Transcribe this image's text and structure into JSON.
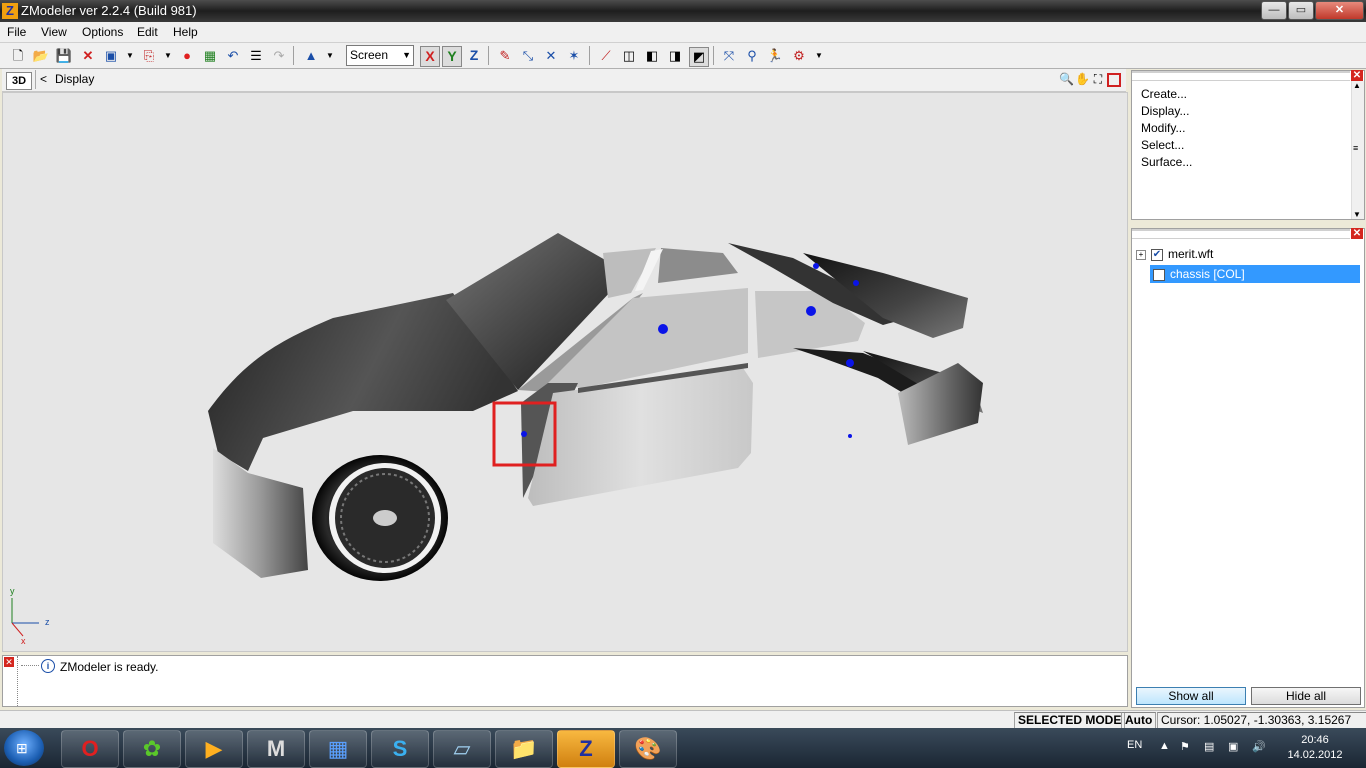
{
  "window": {
    "title": "ZModeler ver 2.2.4 (Build 981)",
    "app_icon": "Z",
    "buttons": {
      "minimize": "—",
      "maximize": "▭",
      "close": "✕"
    }
  },
  "menu": [
    "File",
    "View",
    "Options",
    "Edit",
    "Help"
  ],
  "toolbar": {
    "coord_mode": "Screen",
    "axes": [
      "X",
      "Y",
      "Z"
    ]
  },
  "viewport": {
    "mode_label": "3D",
    "breadcrumb_arrow": "<",
    "breadcrumb": "Display",
    "axis_y": "y",
    "axis_z": "z",
    "axis_x": "x"
  },
  "commands_panel": {
    "items": [
      "Create...",
      "Display...",
      "Modify...",
      "Select...",
      "Surface..."
    ]
  },
  "objects_panel": {
    "items": [
      {
        "label": "merit.wft",
        "checked": true,
        "expander": "+"
      },
      {
        "label": "chassis [COL]",
        "checked": false,
        "selected": true
      }
    ],
    "show_all": "Show all",
    "hide_all": "Hide all"
  },
  "log": {
    "message": "ZModeler is ready.",
    "info_icon": "i"
  },
  "statusbar": {
    "mode": "SELECTED MODE",
    "auto": "Auto",
    "cursor": "Cursor: 1.05027, -1.30363, 3.15267"
  },
  "taskbar": {
    "language": "EN",
    "time": "20:46",
    "date": "14.02.2012"
  },
  "colors": {
    "selection_blue": "#3399ff",
    "highlight_red": "#e02020",
    "vertex_blue": "#0a14e8"
  }
}
